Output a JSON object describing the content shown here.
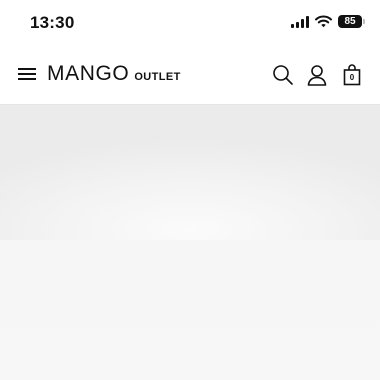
{
  "status_bar": {
    "time": "13:30",
    "battery": "85",
    "signal_icon": "cellular-signal-icon",
    "wifi_icon": "wifi-icon"
  },
  "header": {
    "menu_icon": "hamburger-menu-icon",
    "brand": "MANGO",
    "brand_sub": "OUTLET",
    "search_icon": "search-icon",
    "account_icon": "user-icon",
    "bag_icon": "shopping-bag-icon",
    "bag_count": "0"
  },
  "content": {
    "state": "loading-placeholder"
  }
}
